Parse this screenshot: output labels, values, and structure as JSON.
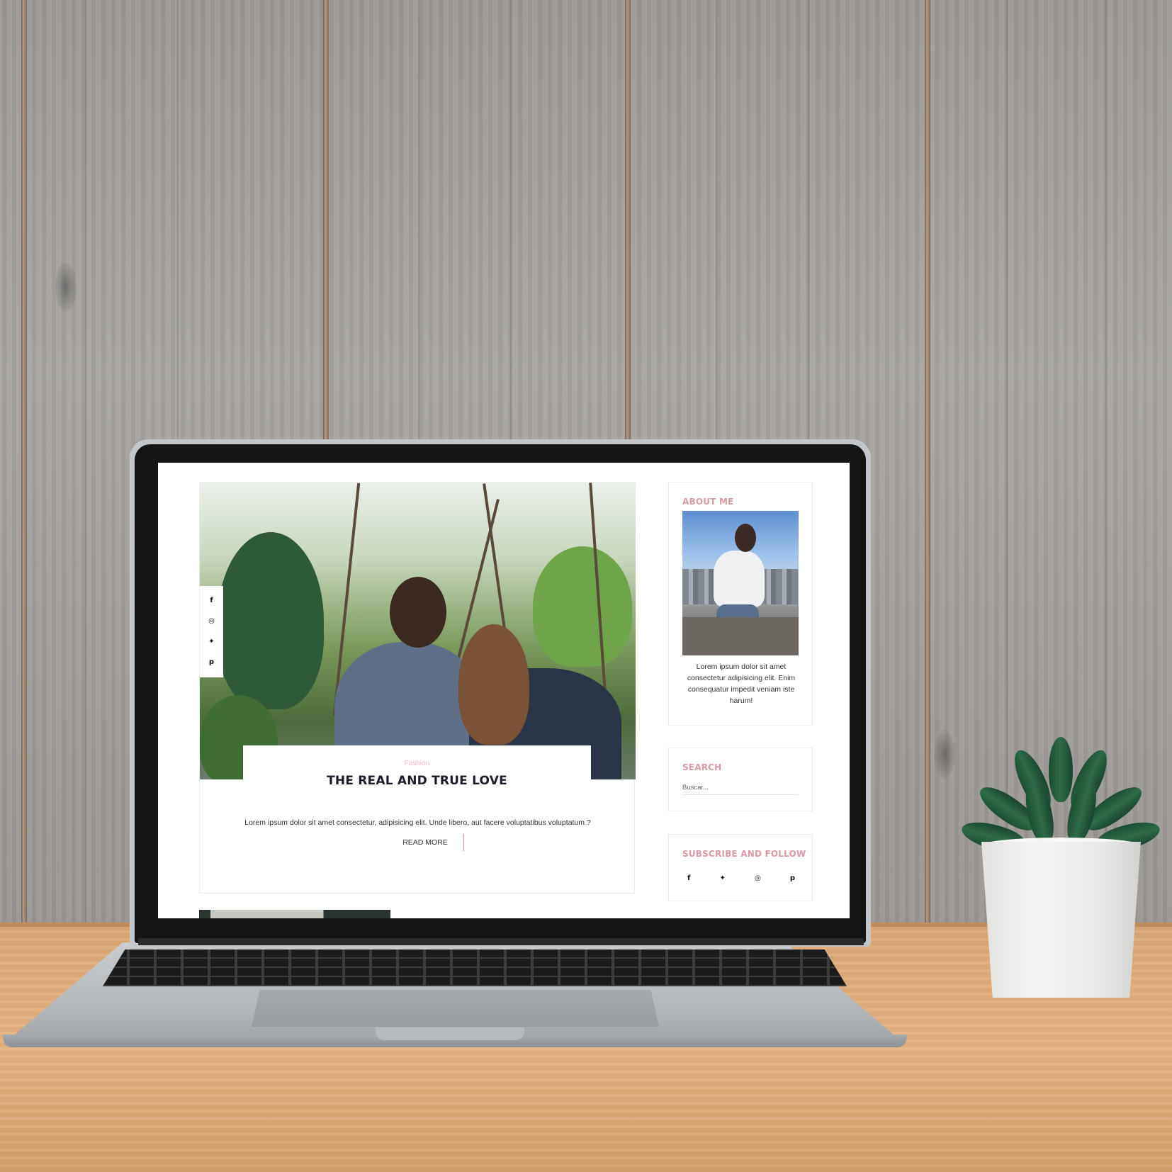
{
  "post": {
    "category": "Fashion",
    "title": "THE REAL AND TRUE LOVE",
    "excerpt": "Lorem ipsum dolor sit amet consectetur, adipisicing elit. Unde libero, aut facere voluptatibus voluptatum ?",
    "read_more": "READ MORE",
    "share_icons": [
      {
        "name": "facebook-icon",
        "glyph": "f"
      },
      {
        "name": "instagram-icon",
        "glyph": "◎"
      },
      {
        "name": "twitter-icon",
        "glyph": "✦"
      },
      {
        "name": "pinterest-icon",
        "glyph": "p"
      }
    ]
  },
  "sidebar": {
    "about": {
      "title": "ABOUT ME",
      "text": "Lorem ipsum dolor sit amet consectetur adipisicing elit. Enim consequatur impedit veniam iste harum!"
    },
    "search": {
      "title": "SEARCH",
      "placeholder": "Buscar..."
    },
    "subscribe": {
      "title": "SUBSCRIBE AND FOLLOW",
      "icons": [
        {
          "name": "facebook-icon",
          "glyph": "f"
        },
        {
          "name": "twitter-icon",
          "glyph": "✦"
        },
        {
          "name": "instagram-icon",
          "glyph": "◎"
        },
        {
          "name": "pinterest-icon",
          "glyph": "p"
        }
      ]
    }
  },
  "colors": {
    "accent_pink": "#d99aa5",
    "category_pink": "#f0b9c2",
    "title_dark": "#1d1d2c"
  }
}
